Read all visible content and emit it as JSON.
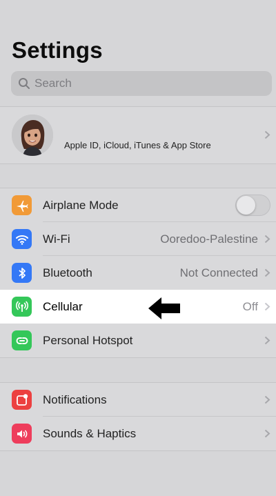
{
  "header": {
    "title": "Settings"
  },
  "search": {
    "placeholder": "Search"
  },
  "profile": {
    "subtitle": "Apple ID, iCloud, iTunes & App Store"
  },
  "connectivity": [
    {
      "label": "Airplane Mode",
      "value": "",
      "icon": "airplane-icon",
      "color": "#f19a37",
      "toggle": false
    },
    {
      "label": "Wi-Fi",
      "value": "Ooredoo-Palestine",
      "icon": "wifi-icon",
      "color": "#3478f6"
    },
    {
      "label": "Bluetooth",
      "value": "Not Connected",
      "icon": "bluetooth-icon",
      "color": "#3478f6"
    },
    {
      "label": "Cellular",
      "value": "Off",
      "icon": "cellular-antenna-icon",
      "color": "#34c759"
    },
    {
      "label": "Personal Hotspot",
      "value": "",
      "icon": "hotspot-link-icon",
      "color": "#34c759"
    }
  ],
  "notifications_group": [
    {
      "label": "Notifications",
      "icon": "notifications-icon",
      "color": "#ec4040"
    },
    {
      "label": "Sounds & Haptics",
      "icon": "speaker-icon",
      "color": "#ee3d5c"
    }
  ]
}
